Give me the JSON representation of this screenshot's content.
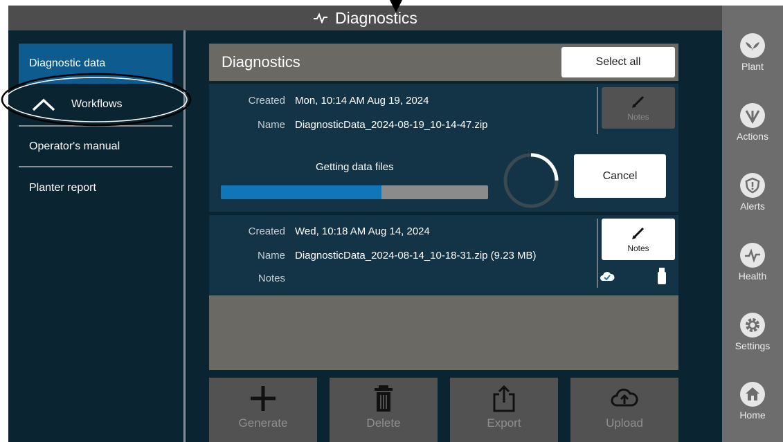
{
  "window": {
    "title": "Diagnostics",
    "title_icon": "heartbeat-icon"
  },
  "sidebar": {
    "items": [
      {
        "label": "Diagnostic data",
        "selected": true
      },
      {
        "label": "Workflows",
        "icon": "chevron-up-icon"
      },
      {
        "label": "Operator's manual"
      },
      {
        "label": "Planter report"
      }
    ]
  },
  "main": {
    "title": "Diagnostics",
    "select_all_label": "Select all",
    "entries": [
      {
        "created_label": "Created",
        "created_value": "Mon, 10:14 AM Aug 19, 2024",
        "name_label": "Name",
        "name_value": "DiagnosticData_2024-08-19_10-14-47.zip",
        "notes_button": "Notes",
        "progress_label": "Getting data files",
        "progress_fraction": 0.6,
        "cancel_label": "Cancel"
      },
      {
        "created_label": "Created",
        "created_value": "Wed, 10:18 AM Aug 14, 2024",
        "name_label": "Name",
        "name_value": "DiagnosticData_2024-08-14_10-18-31.zip (9.23 MB)",
        "notes_label": "Notes",
        "notes_button": "Notes",
        "status_icons": [
          "cloud-check-icon",
          "usb-drive-icon"
        ]
      }
    ]
  },
  "toolbar": {
    "generate": "Generate",
    "delete": "Delete",
    "export": "Export",
    "upload": "Upload"
  },
  "nav": {
    "plant": "Plant",
    "actions": "Actions",
    "alerts": "Alerts",
    "health": "Health",
    "settings": "Settings",
    "home": "Home"
  },
  "colors": {
    "background": "#0b2431",
    "selected": "#0d5b8f",
    "progress": "#1176b8",
    "nav": "#6d6d6d"
  }
}
